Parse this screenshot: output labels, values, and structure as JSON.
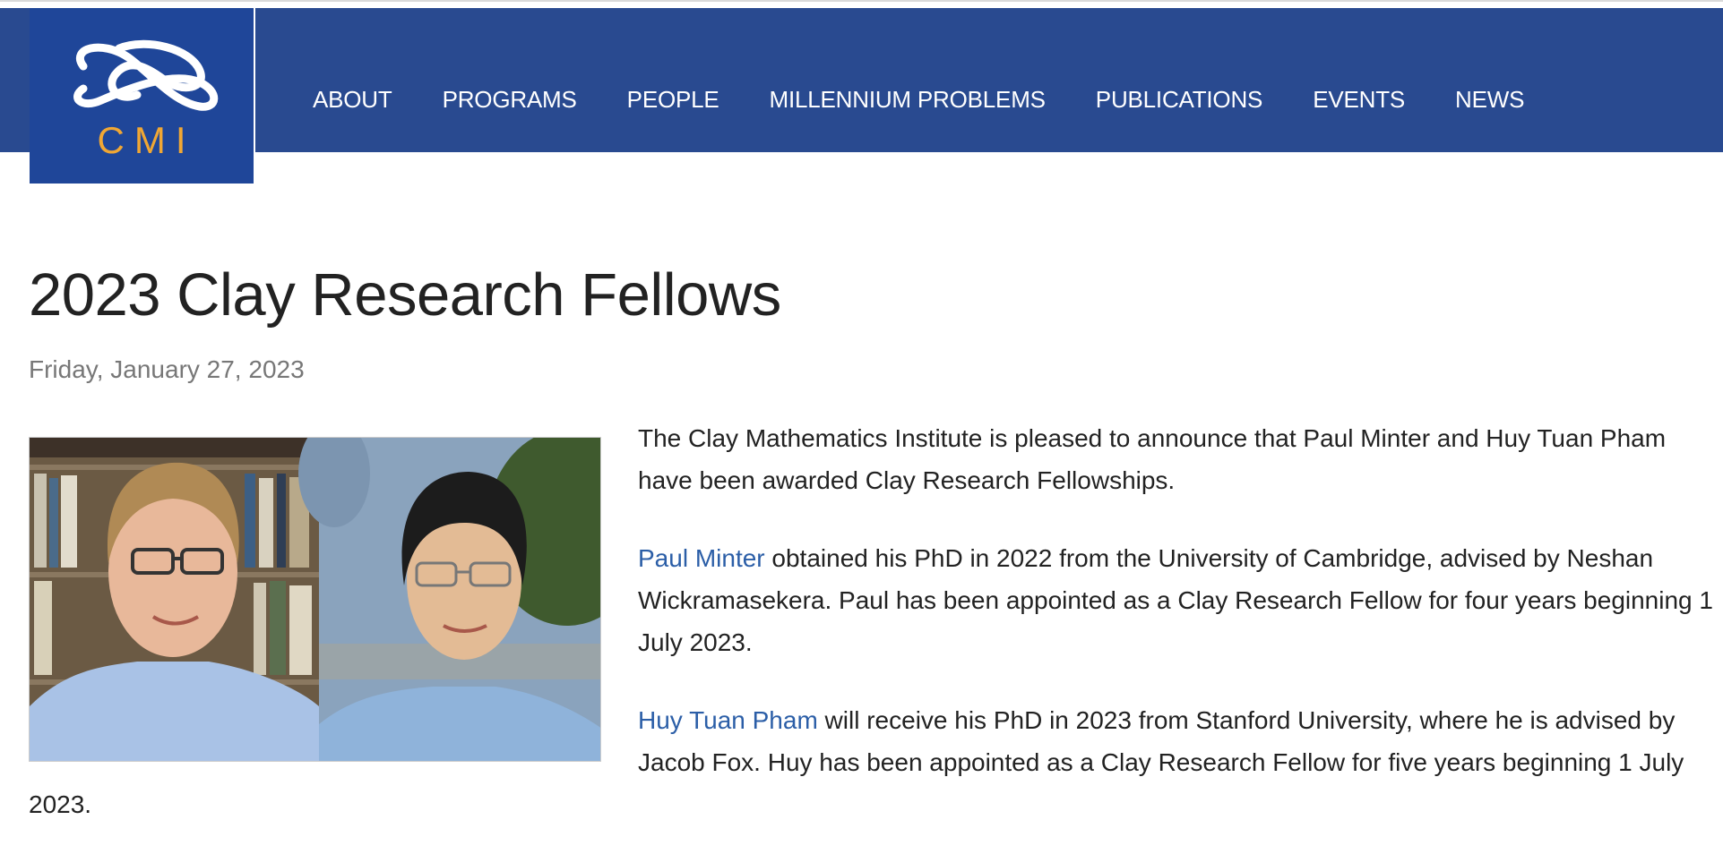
{
  "header": {
    "logo_text": "CMI",
    "nav": [
      "ABOUT",
      "PROGRAMS",
      "PEOPLE",
      "MILLENNIUM PROBLEMS",
      "PUBLICATIONS",
      "EVENTS",
      "NEWS"
    ]
  },
  "article": {
    "title": "2023 Clay Research Fellows",
    "date": "Friday, January 27, 2023",
    "p1": "The Clay Mathematics Institute is pleased to announce that Paul Minter and Huy Tuan Pham have been awarded Clay Research Fellowships.",
    "p2_link": "Paul Minter",
    "p2_text": " obtained his PhD in 2022 from the University of Cambridge, advised by Neshan Wickramasekera.  Paul has been appointed as a Clay Research Fellow for four years beginning 1 July 2023.",
    "p3_link": "Huy Tuan Pham",
    "p3_text": " will receive his PhD in 2023 from Stanford University, where he is advised by Jacob Fox.  Huy has been appointed as a Clay Research Fellow for five years beginning 1 July",
    "p3_tail": "2023."
  },
  "colors": {
    "nav_bg": "#294a90",
    "logo_bg": "#1f4699",
    "logo_text": "#f0a734",
    "link": "#2b5ea7",
    "date": "#777777"
  }
}
